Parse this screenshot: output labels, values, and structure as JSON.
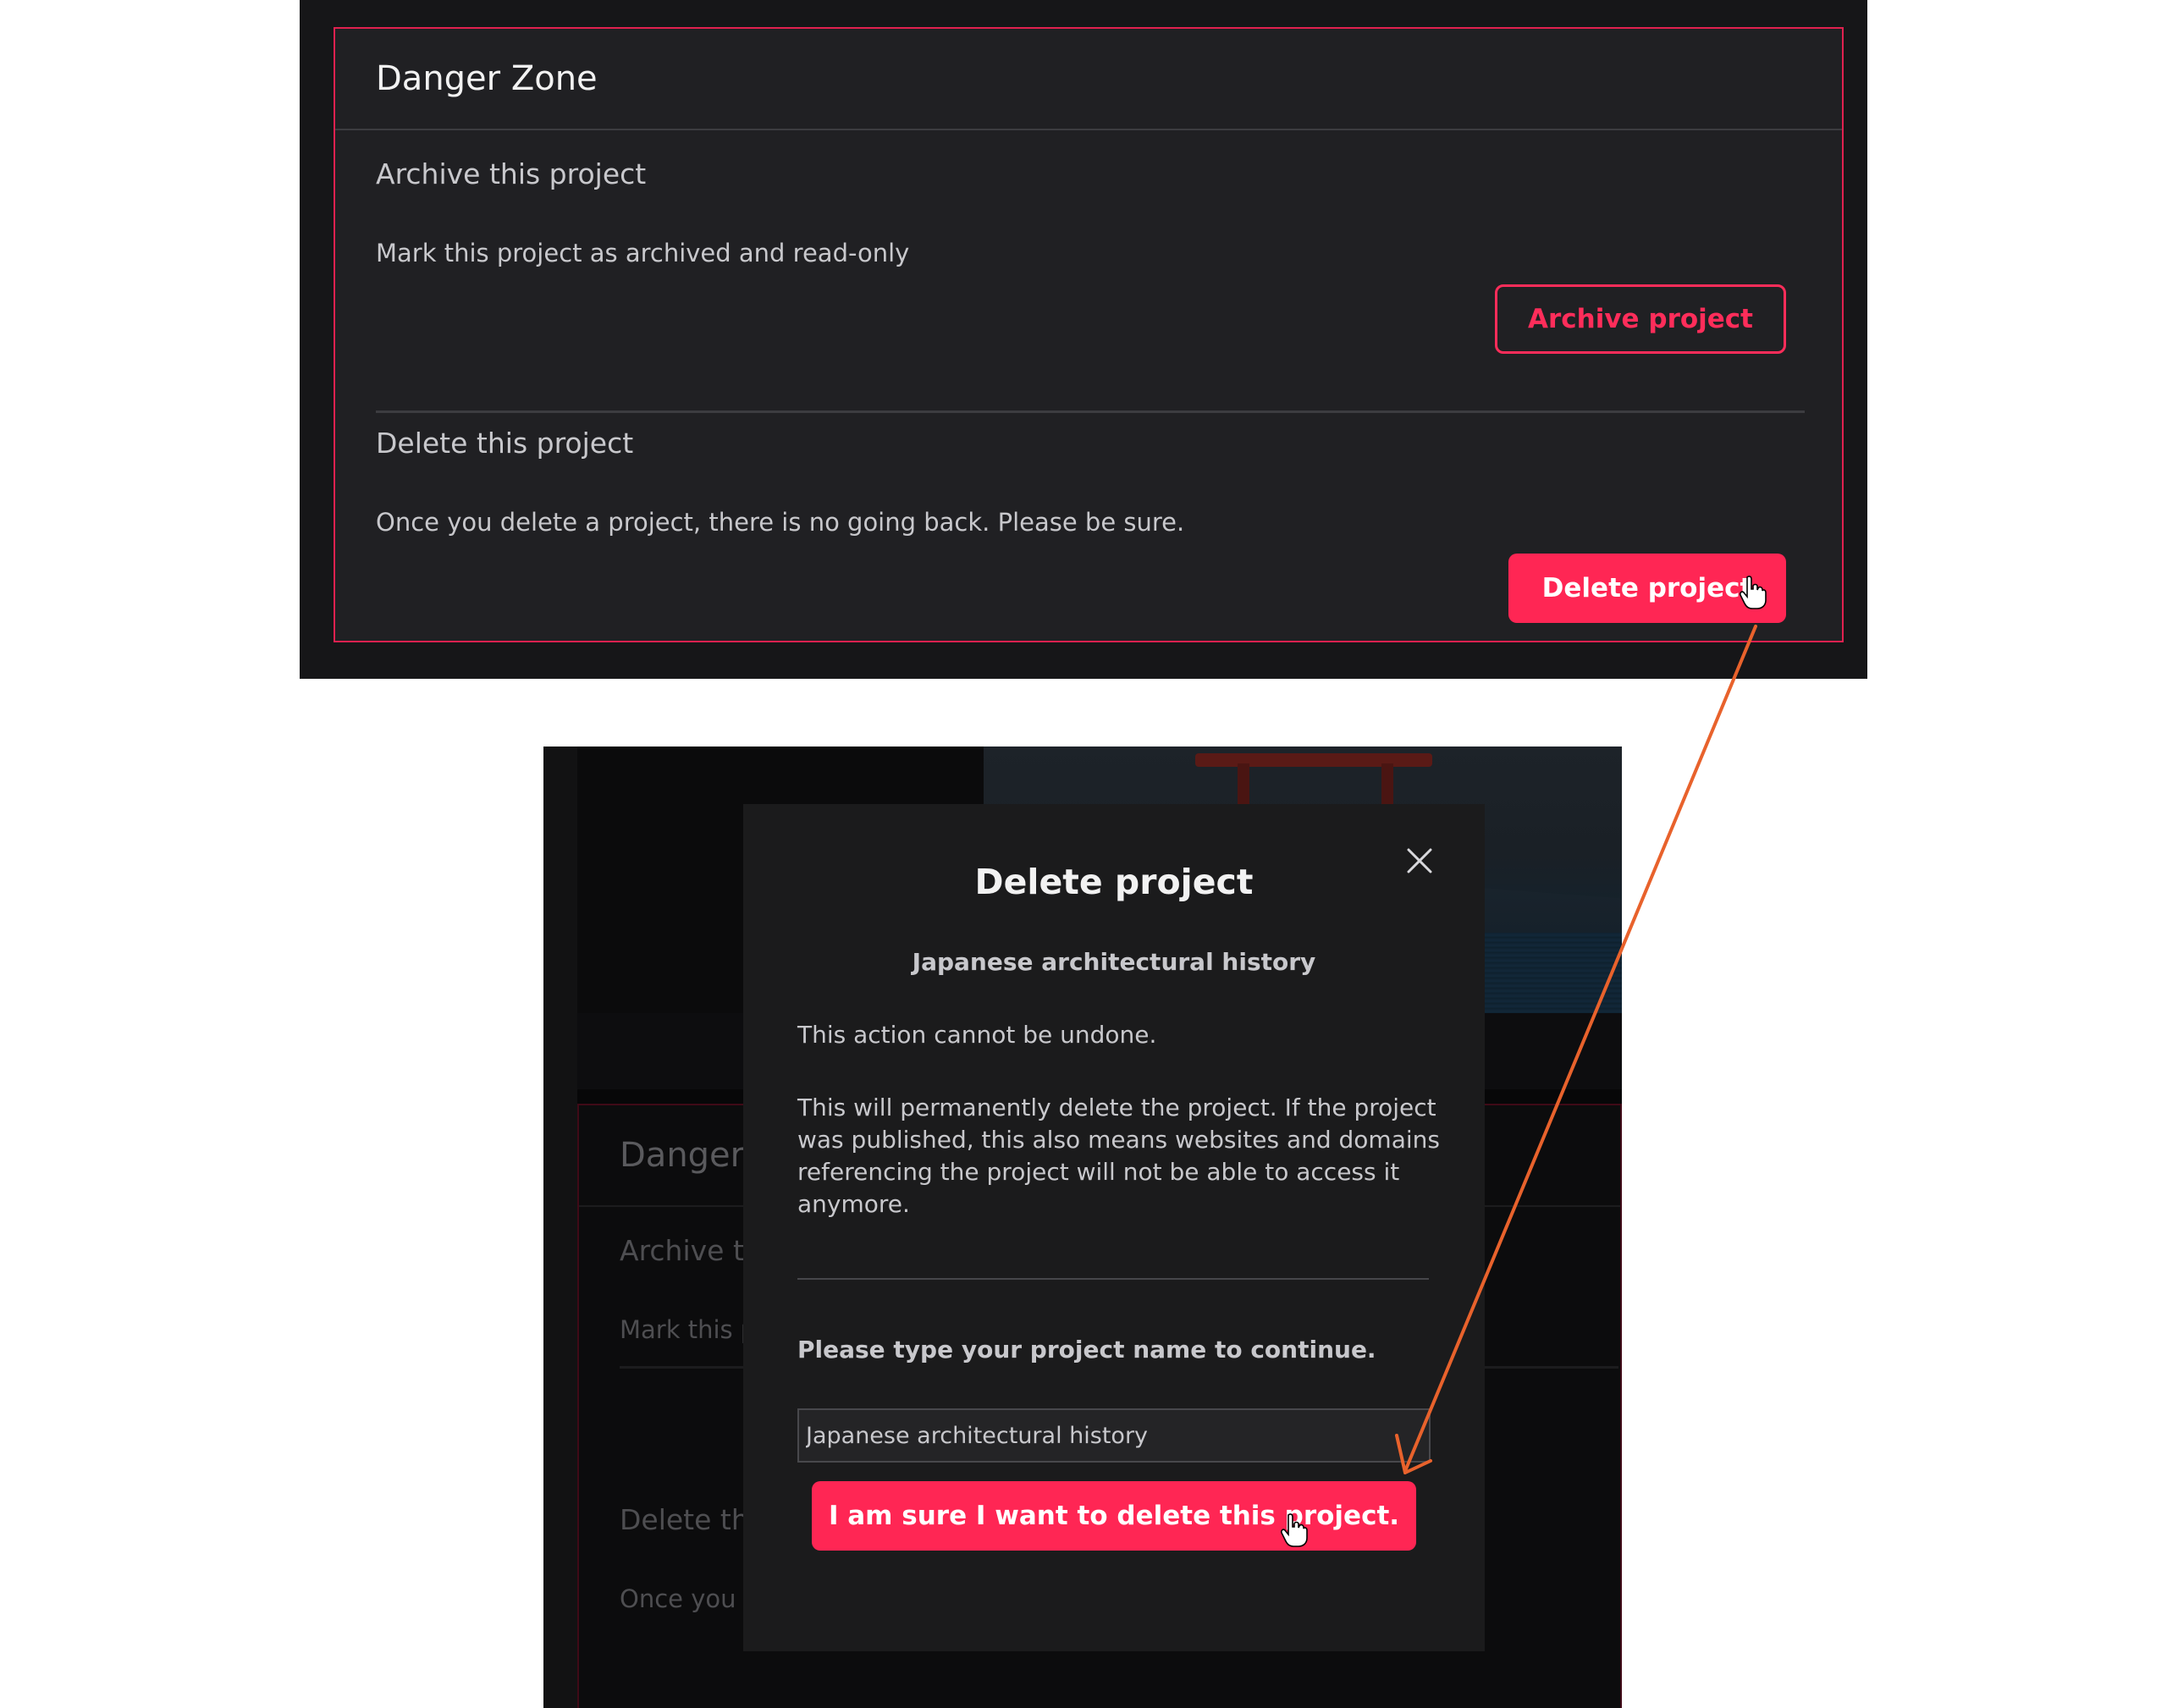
{
  "danger_zone": {
    "title": "Danger Zone",
    "archive": {
      "heading": "Archive this project",
      "description": "Mark this project as archived and read-only",
      "button_label": "Archive project"
    },
    "delete": {
      "heading": "Delete this project",
      "description": "Once you delete a project, there is no going back. Please be sure.",
      "button_label": "Delete project"
    }
  },
  "background_partial": {
    "title": "Danger",
    "archive_heading": "Archive th",
    "archive_desc": "Mark this p",
    "delete_heading": "Delete th",
    "delete_desc": "Once you c"
  },
  "modal": {
    "title": "Delete project",
    "project_name": "Japanese architectural history",
    "warning": "This action cannot be undone.",
    "details": "This will permanently delete the project. If the project was published, this also means websites and domains referencing the project will not be able to access it anymore.",
    "prompt": "Please type your project name to continue.",
    "input_value": "Japanese architectural history",
    "confirm_label": "I am sure I want to delete this project."
  },
  "icons": {
    "close": "close-icon",
    "cursor": "hand-pointer-icon",
    "arrow": "flow-arrow"
  },
  "colors": {
    "accent": "#ff2654",
    "panel_bg": "#202023",
    "page_bg": "#161618",
    "annotation_arrow": "#e8622c"
  }
}
